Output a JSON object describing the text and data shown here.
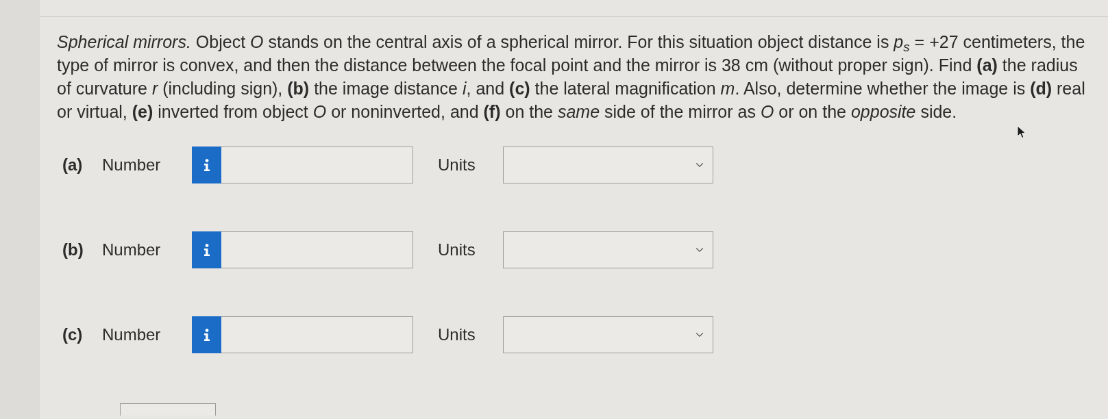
{
  "question": {
    "text": "*Spherical mirrors.* Object *O* stands on the central axis of a spherical mirror. For this situation object distance is *p*$_{s}$ = +27 centimeters, the type of mirror is convex, and then the distance between the focal point and the mirror is 38 cm (without proper sign). Find **(a)** the radius of curvature *r* (including sign), **(b)** the image distance *i*, and **(c)** the lateral magnification *m*. Also, determine whether the image is **(d)** real or virtual, **(e)** inverted from object *O* or noninverted, and **(f)** on the *same* side of the mirror as *O* or on the *opposite* side."
  },
  "parts": [
    {
      "label": "(a)",
      "number_label": "Number",
      "units_label": "Units"
    },
    {
      "label": "(b)",
      "number_label": "Number",
      "units_label": "Units"
    },
    {
      "label": "(c)",
      "number_label": "Number",
      "units_label": "Units"
    }
  ]
}
